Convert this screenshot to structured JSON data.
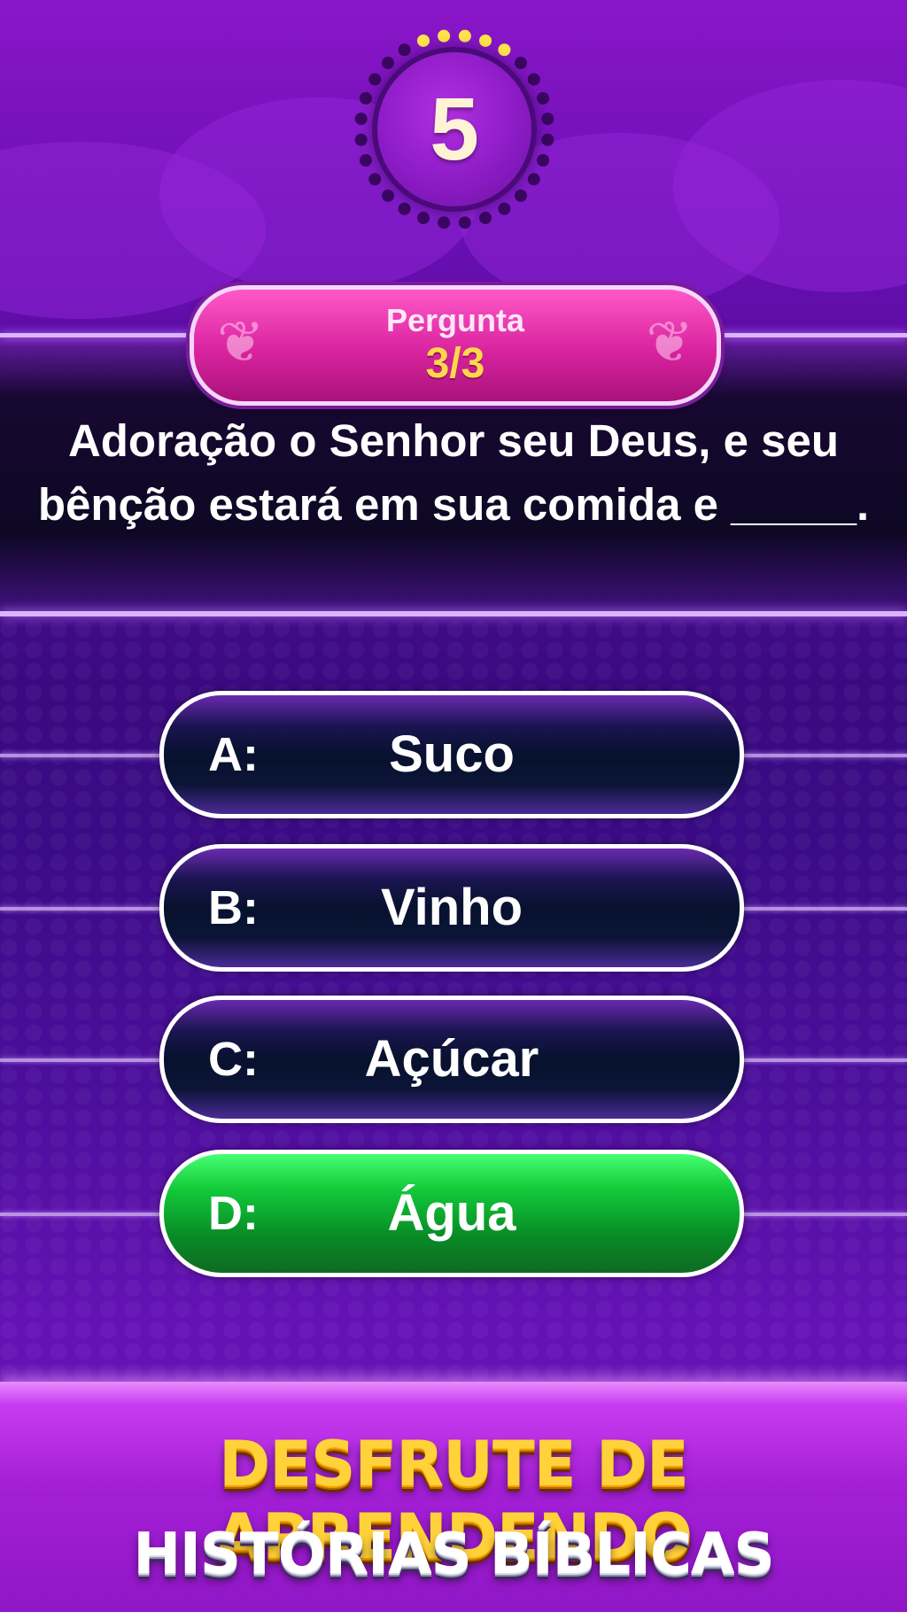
{
  "timer": {
    "value": "5",
    "progress_dots_lit": 5,
    "progress_dots_total": 28
  },
  "question": {
    "badge_label": "Pergunta",
    "count": "3/3",
    "text": "Adoração o Senhor seu Deus, e seu bênção estará em sua comida e _____."
  },
  "answers": [
    {
      "letter": "A:",
      "label": "Suco",
      "state": "default"
    },
    {
      "letter": "B:",
      "label": "Vinho",
      "state": "default"
    },
    {
      "letter": "C:",
      "label": "Açúcar",
      "state": "default"
    },
    {
      "letter": "D:",
      "label": "Água",
      "state": "correct"
    }
  ],
  "banner": {
    "line1": "DESFRUTE DE APRENDENDO",
    "line2": "HISTÓRIAS BÍBLICAS"
  },
  "colors": {
    "background": "#4e0a96",
    "badge": "#d9239f",
    "count": "#ffd84a",
    "answer_default": "#07122e",
    "answer_correct": "#12c93a",
    "banner_yellow": "#ffd23a"
  }
}
